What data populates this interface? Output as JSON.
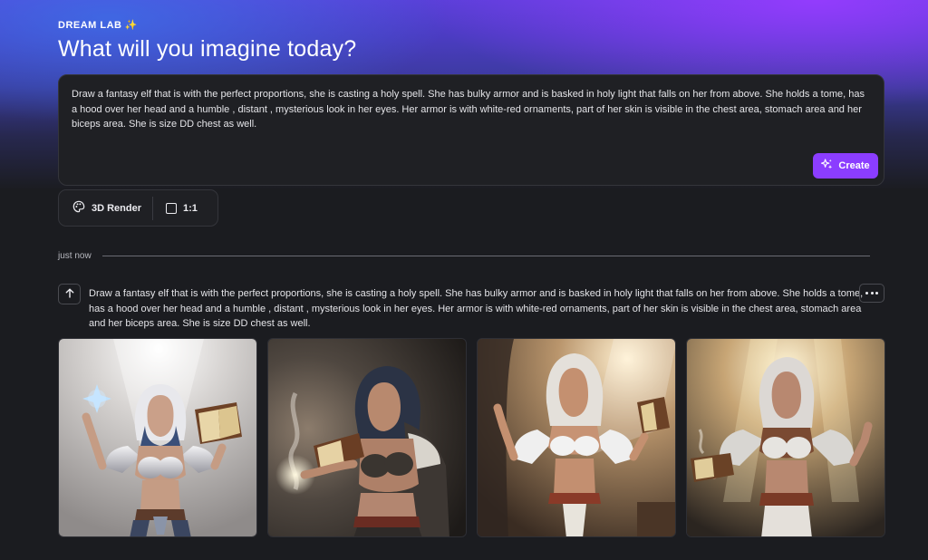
{
  "header": {
    "brand": "DREAM LAB",
    "brand_sparkle": "✨",
    "title": "What will you imagine today?"
  },
  "prompt": {
    "text": "Draw a fantasy elf that is with the perfect proportions, she is casting a holy spell. She has bulky armor and is basked in holy light that falls on her from above. She holds a tome, has a hood over her head and a humble , distant , mysterious look in her eyes. Her armor is with white-red ornaments, part of her skin is visible in the chest area, stomach area and her biceps area. She is size DD chest as well.",
    "create_label": "Create"
  },
  "options": {
    "style_label": "3D Render",
    "ratio_label": "1:1"
  },
  "history": {
    "timestamp": "just now",
    "prompt_text": "Draw a fantasy elf that is with the perfect proportions, she is casting a holy spell. She has bulky armor and is basked in holy light that falls on her from above. She holds a tome, has a hood over her head and a humble , distant , mysterious look in her eyes. Her armor is with white-red ornaments, part of her skin is visible in the chest area, stomach area and her biceps area. She is size DD chest as well.",
    "images": [
      {
        "name": "generated-image-1"
      },
      {
        "name": "generated-image-2"
      },
      {
        "name": "generated-image-3"
      },
      {
        "name": "generated-image-4"
      }
    ]
  },
  "colors": {
    "accent": "#8b3dff",
    "background": "#1b1c20",
    "panel": "#1f2024"
  },
  "icons": {
    "brand": "sparkle-icon",
    "create": "magic-sparkle-icon",
    "style": "palette-icon",
    "ratio": "square-icon",
    "reuse": "arrow-up-icon",
    "more": "more-dots-icon"
  }
}
